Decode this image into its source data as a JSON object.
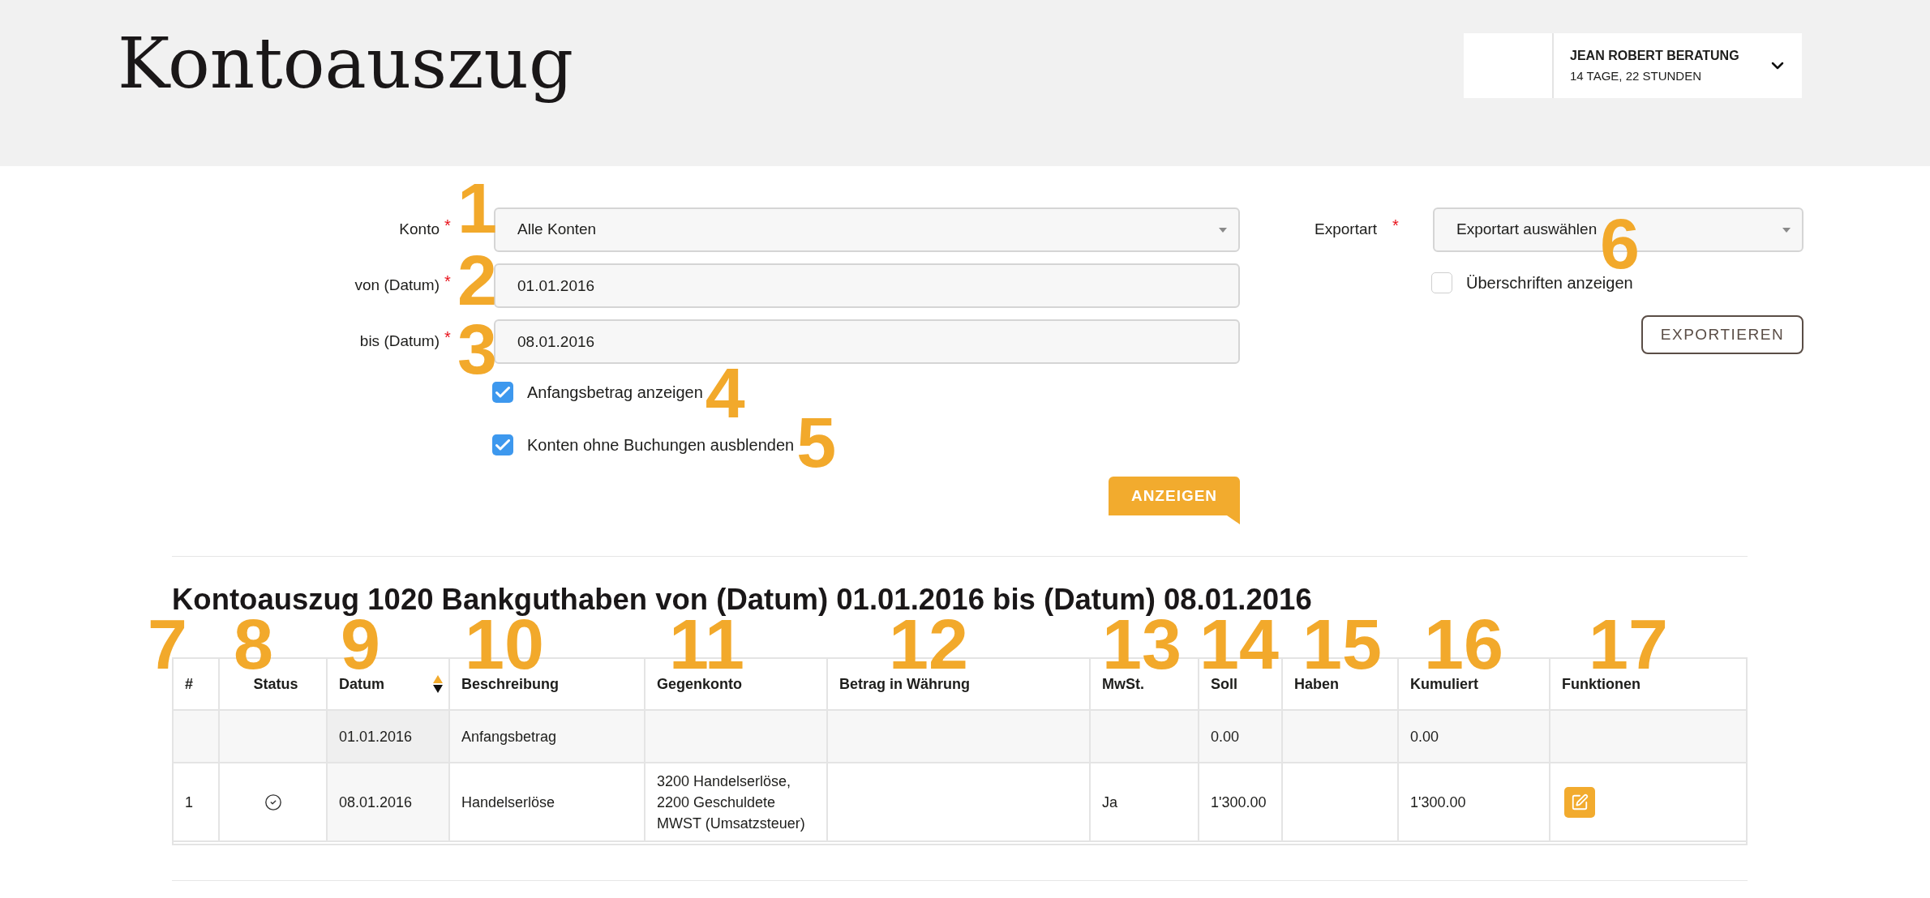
{
  "header": {
    "title": "Kontoauszug",
    "account": {
      "name": "JEAN ROBERT BERATUNG",
      "remaining": "14 TAGE, 22 STUNDEN"
    }
  },
  "filter": {
    "fields": [
      {
        "kind": "select",
        "label": "Konto",
        "required_mark": "*",
        "value": "Alle Konten",
        "marker": "1"
      },
      {
        "kind": "text",
        "label": "von (Datum)",
        "required_mark": "*",
        "value": "01.01.2016",
        "marker": "2"
      },
      {
        "kind": "text",
        "label": "bis (Datum)",
        "required_mark": "*",
        "value": "08.01.2016",
        "marker": "3"
      }
    ],
    "options": [
      {
        "label": "Anfangsbetrag anzeigen",
        "checked": true,
        "marker": "4"
      },
      {
        "label": "Konten ohne Buchungen ausblenden",
        "checked": true,
        "marker": "5"
      }
    ],
    "submit": "ANZEIGEN"
  },
  "export": {
    "label": "Exportart",
    "required_mark": "*",
    "value": "Exportart auswählen",
    "marker": "6",
    "option": {
      "label": "Überschriften anzeigen",
      "checked": false
    },
    "button": "EXPORTIEREN"
  },
  "report": {
    "title": "Kontoauszug 1020 Bankguthaben von (Datum) 01.01.2016 bis (Datum) 08.01.2016",
    "table": {
      "columns": [
        {
          "label": "#",
          "marker": "7"
        },
        {
          "label": "Status",
          "marker": "8"
        },
        {
          "label": "Datum",
          "marker": "9",
          "ascending": true
        },
        {
          "label": "Beschreibung",
          "marker": "10"
        },
        {
          "label": "Gegenkonto",
          "marker": "11"
        },
        {
          "label": "Betrag in Währung",
          "marker": "12"
        },
        {
          "label": "MwSt.",
          "marker": "13"
        },
        {
          "label": "Soll",
          "marker": "14"
        },
        {
          "label": "Haben",
          "marker": "15"
        },
        {
          "label": "Kumuliert",
          "marker": "16"
        },
        {
          "label": "Funktionen",
          "marker": "17"
        }
      ],
      "rows": [
        {
          "kind": "opening",
          "date": "01.01.2016",
          "description": "Anfangsbetrag",
          "debit": "0.00",
          "cumulative": "0.00"
        },
        {
          "kind": "entry",
          "number": "1",
          "confirmed": true,
          "date": "08.01.2016",
          "description": "Handelserlöse",
          "counter_account": "3200 Handelserlöse, 2200 Geschuldete MWST (Umsatzsteuer)",
          "vat": "Ja",
          "debit": "1'300.00",
          "cumulative": "1'300.00",
          "actions": [
            {
              "kind": "edit"
            }
          ]
        }
      ]
    }
  }
}
